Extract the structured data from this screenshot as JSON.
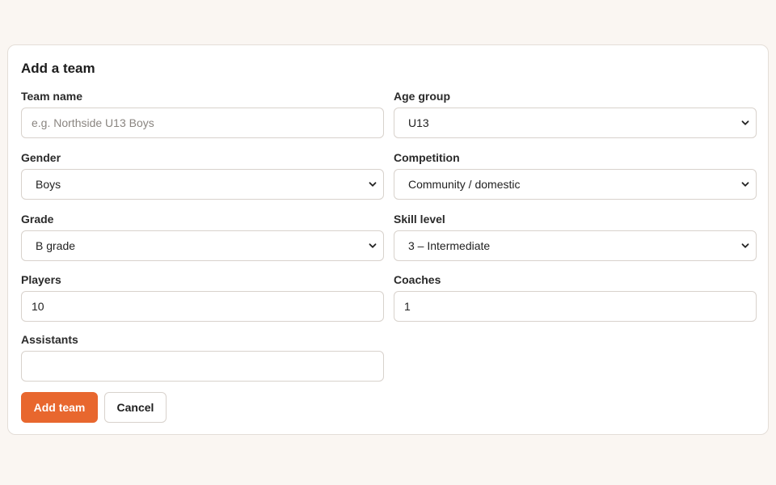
{
  "form": {
    "title": "Add a team",
    "team_name": {
      "label": "Team name",
      "value": "",
      "placeholder": "e.g. Northside U13 Boys"
    },
    "age_group": {
      "label": "Age group",
      "value": "U13"
    },
    "gender": {
      "label": "Gender",
      "value": "Boys"
    },
    "competition": {
      "label": "Competition",
      "value": "Community / domestic"
    },
    "grade": {
      "label": "Grade",
      "value": "B grade"
    },
    "skill_level": {
      "label": "Skill level",
      "value": "3 – Intermediate"
    },
    "players": {
      "label": "Players",
      "value": "10"
    },
    "coaches": {
      "label": "Coaches",
      "value": "1"
    },
    "assistants": {
      "label": "Assistants",
      "value": ""
    },
    "submit_label": "Add team",
    "cancel_label": "Cancel"
  },
  "colors": {
    "accent": "#e8672e",
    "background": "#faf6f2",
    "border": "#d8d2cc"
  }
}
